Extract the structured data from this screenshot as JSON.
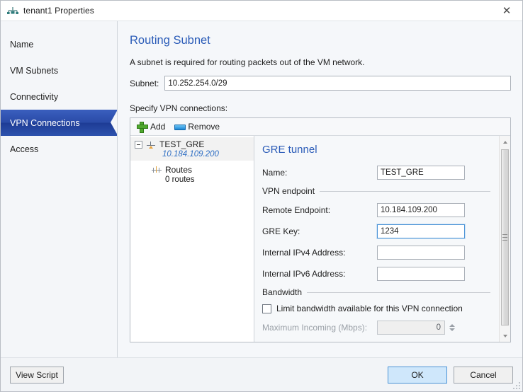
{
  "window": {
    "title": "tenant1 Properties",
    "icon": "network-tenant-icon",
    "close_label": "✕"
  },
  "sidebar": {
    "items": [
      {
        "label": "Name",
        "selected": false
      },
      {
        "label": "VM Subnets",
        "selected": false
      },
      {
        "label": "Connectivity",
        "selected": false
      },
      {
        "label": "VPN Connections",
        "selected": true
      },
      {
        "label": "Access",
        "selected": false
      }
    ]
  },
  "content": {
    "heading": "Routing Subnet",
    "description": "A subnet is required for routing packets out of the VM network.",
    "subnet_label": "Subnet:",
    "subnet_value": "10.252.254.0/29",
    "subnet_placeholder": "",
    "specify_label": "Specify VPN connections:"
  },
  "toolbar": {
    "add_label": "Add",
    "remove_label": "Remove"
  },
  "tree": {
    "node_title": "TEST_GRE",
    "node_subtitle": "10.184.109.200",
    "child_title": "Routes",
    "child_subtitle": "0 routes"
  },
  "detail": {
    "heading": "GRE tunnel",
    "name_label": "Name:",
    "name_value": "TEST_GRE",
    "endpoint_group": "VPN endpoint",
    "remote_endpoint_label": "Remote Endpoint:",
    "remote_endpoint_value": "10.184.109.200",
    "gre_key_label": "GRE Key:",
    "gre_key_value": "1234",
    "ipv4_label": "Internal IPv4 Address:",
    "ipv4_value": "",
    "ipv6_label": "Internal IPv6 Address:",
    "ipv6_value": "",
    "bandwidth_group": "Bandwidth",
    "limit_checkbox_label": "Limit bandwidth available for this VPN connection",
    "limit_checked": false,
    "max_incoming_label": "Maximum Incoming (Mbps):",
    "max_incoming_value": "0"
  },
  "footer": {
    "view_script_label": "View Script",
    "ok_label": "OK",
    "cancel_label": "Cancel"
  },
  "colors": {
    "accent_heading": "#2b5cb8",
    "selected_nav": "#1e3c96",
    "tree_link": "#2f6fc4",
    "ok_button": "#cfe7fb",
    "add_icon": "#4fa82e",
    "remove_icon": "#1a86d6"
  }
}
